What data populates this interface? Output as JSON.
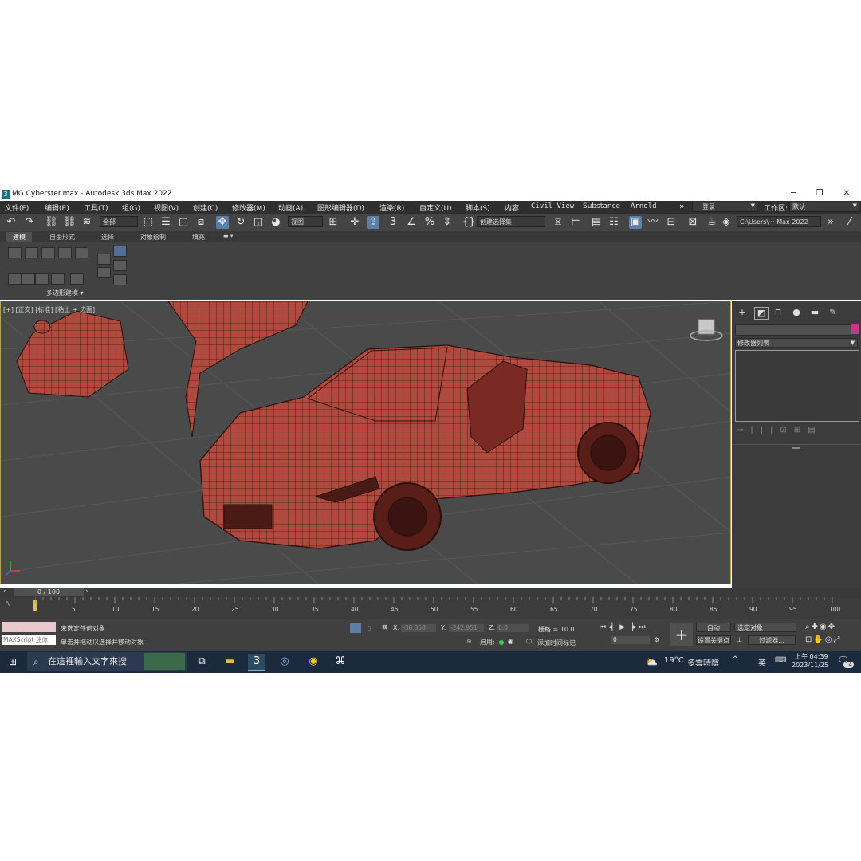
{
  "window": {
    "app_icon": "3",
    "title": "MG Cyberster.max - Autodesk 3ds Max 2022",
    "controls": [
      "─",
      "❐",
      "✕"
    ]
  },
  "menu": {
    "items": [
      "文件(F)",
      "编辑(E)",
      "工具(T)",
      "组(G)",
      "视图(V)",
      "创建(C)",
      "修改器(M)",
      "动画(A)",
      "图形编辑器(D)",
      "渲染(R)",
      "自定义(U)",
      "脚本(S)",
      "内容",
      "Civil View",
      "Substance",
      "Arnold"
    ],
    "more": "»",
    "login": "登录",
    "workspace_label": "工作区:",
    "workspace_value": "默认"
  },
  "toolbar": {
    "selection_filter": "全部",
    "ref_coord": "视图",
    "named_selection": "创建选择集",
    "project_path": "C:\\Users\\··· Max 2022"
  },
  "ribbon": {
    "tabs": [
      "建模",
      "自由形式",
      "选择",
      "对象绘制",
      "填充"
    ],
    "active_tab": "建模",
    "panel_label": "多边形建模 ▾"
  },
  "viewport": {
    "label": "[+] [正交] [标准] [粘土 + 边面]",
    "subject": "wireframe red car model"
  },
  "command_panel": {
    "tab_icons": [
      "plus-icon",
      "modify-icon",
      "hierarchy-icon",
      "motion-icon",
      "display-icon",
      "utilities-icon"
    ],
    "modifier_list": "修改器列表",
    "swatch_color": "#c03a8a"
  },
  "timeline": {
    "frame_display": "0 / 100",
    "ticks": [
      "5",
      "10",
      "15",
      "20",
      "25",
      "30",
      "35",
      "40",
      "45",
      "50",
      "55",
      "60",
      "65",
      "70",
      "75",
      "80",
      "85",
      "90",
      "95",
      "100"
    ]
  },
  "status": {
    "maxscript_label": "MAXScript 迷你",
    "line1": "未选定任何对象",
    "line2": "单击并拖动以选择并移动对象",
    "x_label": "X:",
    "x_value": "-38.858",
    "y_label": "Y:",
    "y_value": "-242.951",
    "z_label": "Z:",
    "z_value": "0.0",
    "grid": "栅格 = 10.0",
    "enable": "启用:",
    "add_time_tag": "添加时间标记",
    "auto_key": "自动",
    "set_key": "设置关键点",
    "key_filter_sel": "选定对象",
    "filters": "过滤器...",
    "frame_value": "0"
  },
  "taskbar": {
    "search_placeholder": "在這裡輸入文字來搜",
    "weather_temp": "19°C",
    "weather_text": "多雲時陰",
    "ime": "英",
    "time": "上午 04:39",
    "date": "2023/11/25",
    "notifications": "14"
  }
}
